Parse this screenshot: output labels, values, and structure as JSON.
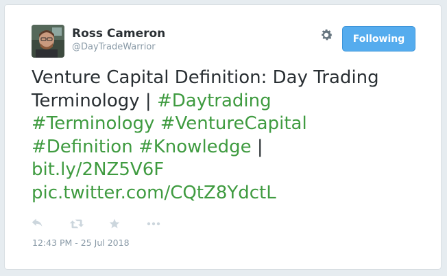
{
  "author": {
    "display_name": "Ross Cameron",
    "handle": "@DayTradeWarrior",
    "avatar": "avatar-photo"
  },
  "follow_button": {
    "label": "Following"
  },
  "tweet": {
    "text_plain": "Venture Capital Definition: Day Trading Terminology | ",
    "hashtags": [
      "#Daytrading",
      "#Terminology",
      "#VentureCapital",
      "#Definition",
      "#Knowledge"
    ],
    "separator": " |",
    "link": "bit.ly/2NZ5V6F",
    "pic_link": "pic.twitter.com/CQtZ8YdctL"
  },
  "actions": [
    {
      "name": "reply-icon"
    },
    {
      "name": "retweet-icon"
    },
    {
      "name": "like-icon"
    },
    {
      "name": "more-icon"
    }
  ],
  "timestamp": "12:43 PM - 25 Jul 2018",
  "colors": {
    "link": "#3f9b40",
    "text": "#292f33",
    "muted": "#8899a6",
    "button": "#55acee",
    "icon": "#ccd6dd"
  }
}
